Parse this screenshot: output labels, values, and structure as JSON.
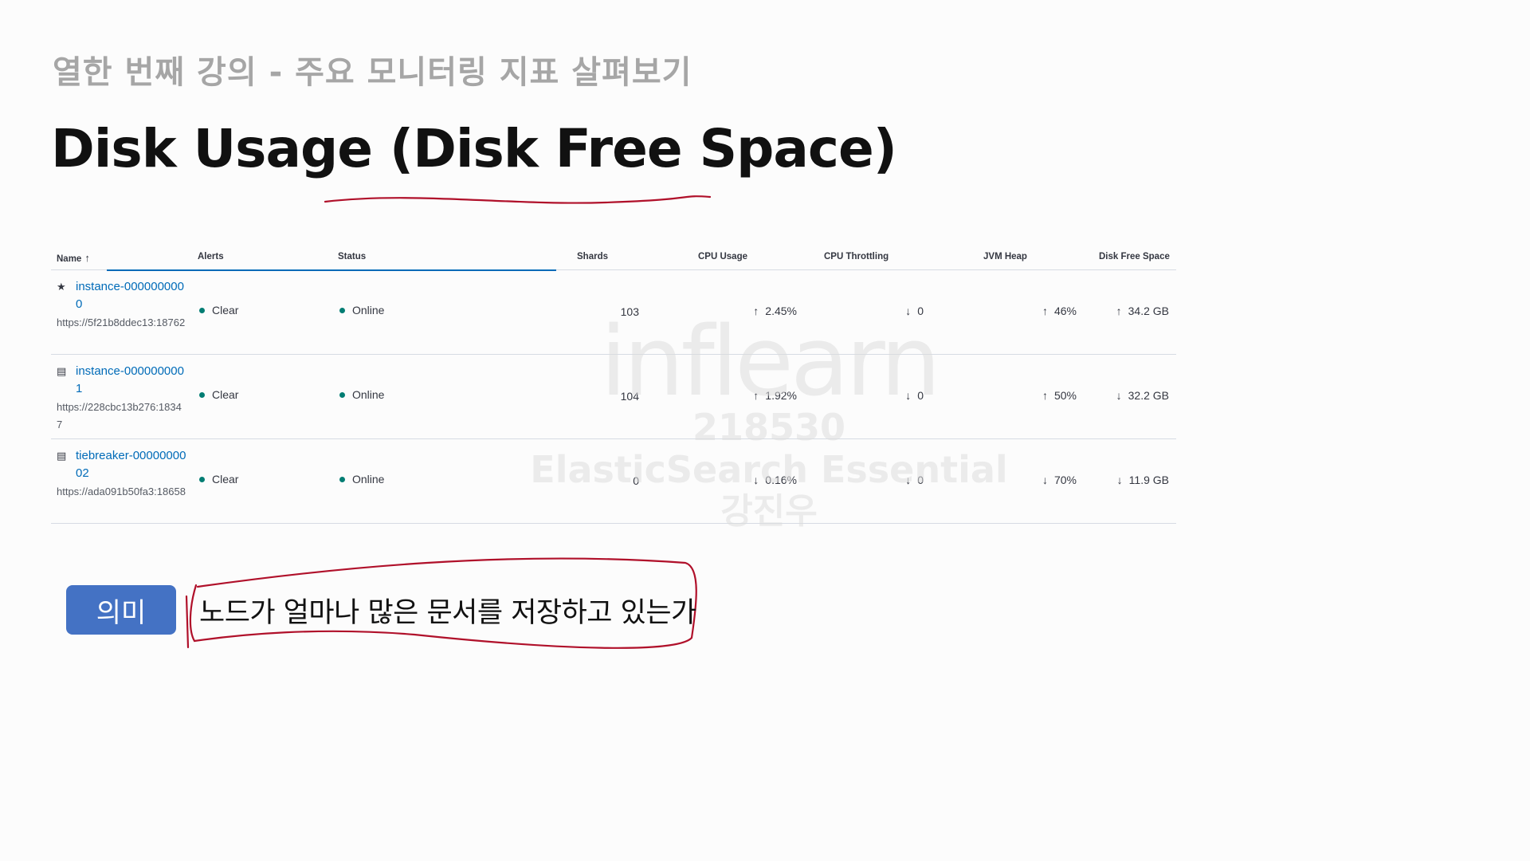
{
  "slide": {
    "subtitle": "열한 번째 강의 - 주요 모니터링 지표 살펴보기",
    "title": "Disk Usage (Disk Free Space)"
  },
  "table": {
    "headers": {
      "name": "Name",
      "alerts": "Alerts",
      "status": "Status",
      "shards": "Shards",
      "cpu_usage": "CPU Usage",
      "cpu_throttling": "CPU Throttling",
      "jvm_heap": "JVM Heap",
      "disk_free_space": "Disk Free Space"
    },
    "sort_icon": "arrow-up-icon",
    "rows": [
      {
        "icon": "star-icon",
        "name": "instance-0000000000",
        "url": "https://5f21b8ddec13:18762",
        "alert": "Clear",
        "status": "Online",
        "shards": "103",
        "cpu_usage": "2.45%",
        "cpu_usage_trend": "up",
        "cpu_throttling": "0",
        "cpu_throttling_trend": "down",
        "jvm_heap": "46%",
        "jvm_heap_trend": "up",
        "disk_free": "34.2 GB",
        "disk_free_trend": "up"
      },
      {
        "icon": "server-icon",
        "name": "instance-0000000001",
        "url": "https://228cbc13b276:18347",
        "alert": "Clear",
        "status": "Online",
        "shards": "104",
        "cpu_usage": "1.92%",
        "cpu_usage_trend": "up",
        "cpu_throttling": "0",
        "cpu_throttling_trend": "down",
        "jvm_heap": "50%",
        "jvm_heap_trend": "up",
        "disk_free": "32.2 GB",
        "disk_free_trend": "down"
      },
      {
        "icon": "server-icon",
        "name": "tiebreaker-0000000002",
        "url": "https://ada091b50fa3:18658",
        "alert": "Clear",
        "status": "Online",
        "shards": "0",
        "cpu_usage": "0.16%",
        "cpu_usage_trend": "down",
        "cpu_throttling": "0",
        "cpu_throttling_trend": "down",
        "jvm_heap": "70%",
        "jvm_heap_trend": "down",
        "disk_free": "11.9 GB",
        "disk_free_trend": "down"
      }
    ]
  },
  "watermark": {
    "logo": "inflearn",
    "id": "218530",
    "course": "ElasticSearch Essential",
    "name": "강진우"
  },
  "meaning": {
    "tag": "의미",
    "text": "노드가 얼마나 많은 문서를 저장하고 있는가"
  },
  "colors": {
    "link": "#006bb8",
    "status_dot": "#017d73",
    "tag_bg": "#4472c4",
    "annotation": "#b0102a"
  }
}
